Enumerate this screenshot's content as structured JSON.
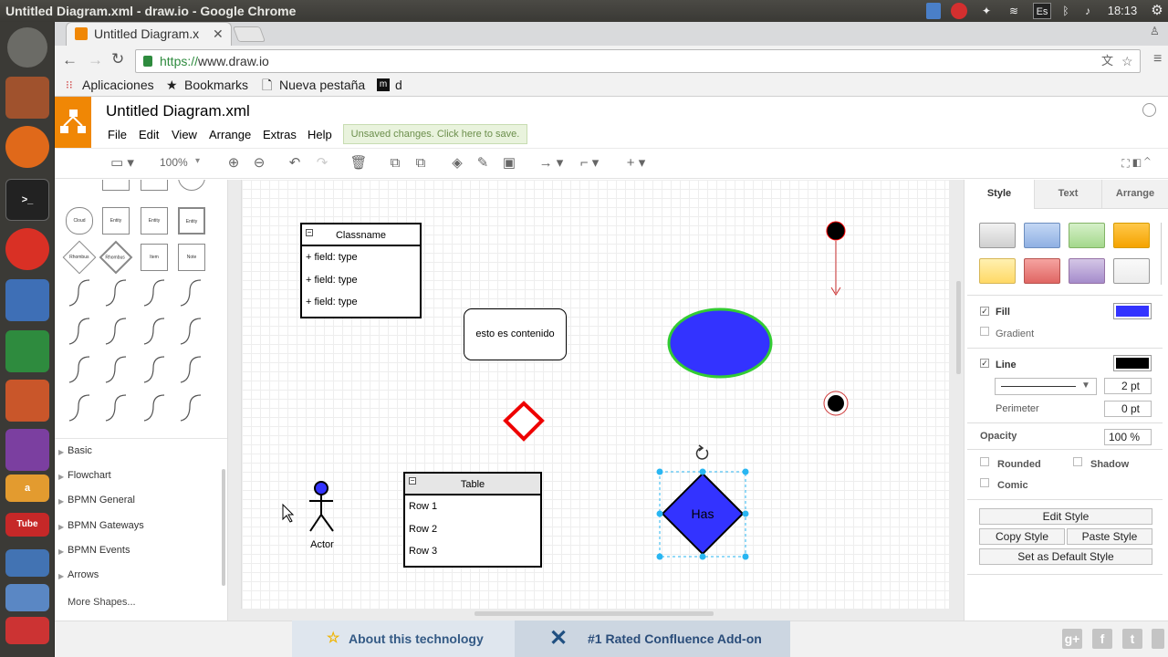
{
  "os": {
    "window_title": "Untitled Diagram.xml - draw.io - Google Chrome",
    "clock": "18:13",
    "keyboard": "Es"
  },
  "browser": {
    "tab_title": "Untitled Diagram.x",
    "url_scheme": "https://",
    "url_host": "www.draw.io",
    "bookmarks": [
      "Aplicaciones",
      "Bookmarks",
      "Nueva pestaña",
      "d"
    ]
  },
  "app": {
    "doc_title": "Untitled Diagram.xml",
    "menus": [
      "File",
      "Edit",
      "View",
      "Arrange",
      "Extras",
      "Help"
    ],
    "unsaved_notice": "Unsaved changes. Click here to save.",
    "zoom": "100%"
  },
  "sidebar": {
    "shape_labels": [
      "Cloud",
      "Entity",
      "Entity",
      "Entity",
      "Rhombus",
      "Rhombus",
      "Item",
      "Note"
    ],
    "categories": [
      "Basic",
      "Flowchart",
      "BPMN General",
      "BPMN Gateways",
      "BPMN Events",
      "Arrows"
    ],
    "more_shapes": "More Shapes..."
  },
  "diagram": {
    "class_title": "Classname",
    "class_fields": [
      "+ field: type",
      "+ field: type",
      "+ field: type"
    ],
    "rounded_text": "esto es contenido",
    "table_title": "Table",
    "table_rows": [
      "Row 1",
      "Row 2",
      "Row 3"
    ],
    "actor_label": "Actor",
    "diamond_label": "Has",
    "ellipse_fill": "#3333ff",
    "ellipse_stroke": "#33cc33",
    "red_diamond_stroke": "#ee0000"
  },
  "panel": {
    "tabs": [
      "Style",
      "Text",
      "Arrange"
    ],
    "swatches": [
      "#e6e6e6",
      "#a9c4eb",
      "#b9e0a5",
      "#ffb30f",
      "#ffe599",
      "#ea6b66",
      "#b5a1d1",
      "#f4f4f4"
    ],
    "fill_label": "Fill",
    "fill_color": "#3333ff",
    "gradient_label": "Gradient",
    "line_label": "Line",
    "line_color": "#000000",
    "line_width": "2 pt",
    "perimeter_label": "Perimeter",
    "perimeter_value": "0 pt",
    "opacity_label": "Opacity",
    "opacity_value": "100 %",
    "rounded_label": "Rounded",
    "shadow_label": "Shadow",
    "comic_label": "Comic",
    "edit_style": "Edit Style",
    "copy_style": "Copy Style",
    "paste_style": "Paste Style",
    "set_default": "Set as Default Style"
  },
  "footer": {
    "ad1": "About this technology",
    "ad2": "#1 Rated Confluence Add-on"
  }
}
